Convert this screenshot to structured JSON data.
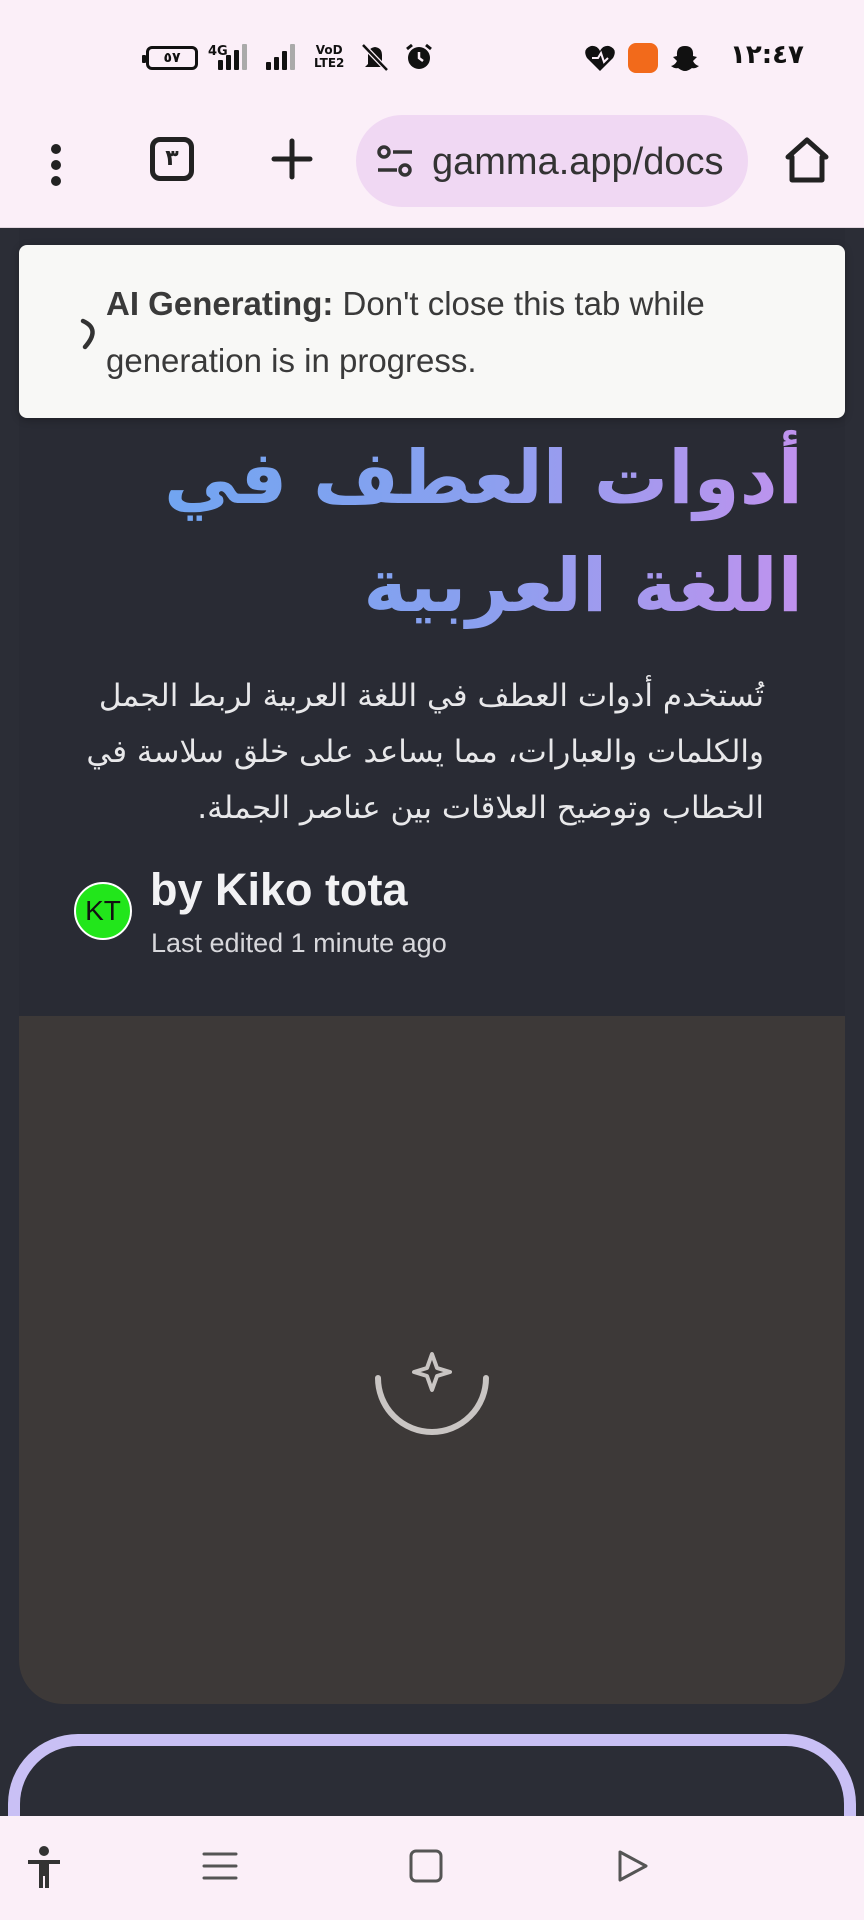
{
  "status_bar": {
    "battery": "٥٧",
    "network": "4G",
    "volte": "VoD\nLTE2",
    "time": "١٢:٤٧"
  },
  "toolbar": {
    "tab_count": "٣",
    "url": "gamma.app/docs"
  },
  "banner": {
    "label": "AI Generating:",
    "message": " Don't close this tab while generation is in progress."
  },
  "doc": {
    "title": "أدوات العطف في اللغة العربية",
    "description": "تُستخدم أدوات العطف في اللغة العربية لربط الجمل والكلمات والعبارات، مما يساعد على خلق سلاسة في الخطاب وتوضيح العلاقات بين عناصر الجملة.",
    "author_initials": "KT",
    "author_line": "by Kiko tota",
    "edited": "Last edited 1 minute ago"
  },
  "colors": {
    "status_bg": "#fbeff8",
    "address_bg": "#f0d8f3",
    "page_bg": "#2b2d36",
    "image_placeholder": "#3d3938",
    "avatar": "#22e61b",
    "title_gradient": [
      "#6aa7f2",
      "#c092ee"
    ],
    "next_card_border": "#c9c0f5"
  },
  "icons": {
    "status": [
      "signal-icon",
      "mute-icon",
      "alarm-icon",
      "heart-icon",
      "app-icon",
      "snapchat-icon"
    ],
    "toolbar": [
      "menu-icon",
      "tabs-icon",
      "plus-icon",
      "tune-icon",
      "home-icon"
    ],
    "nav": [
      "accessibility-icon",
      "recents-icon",
      "home-icon",
      "back-icon"
    ]
  }
}
